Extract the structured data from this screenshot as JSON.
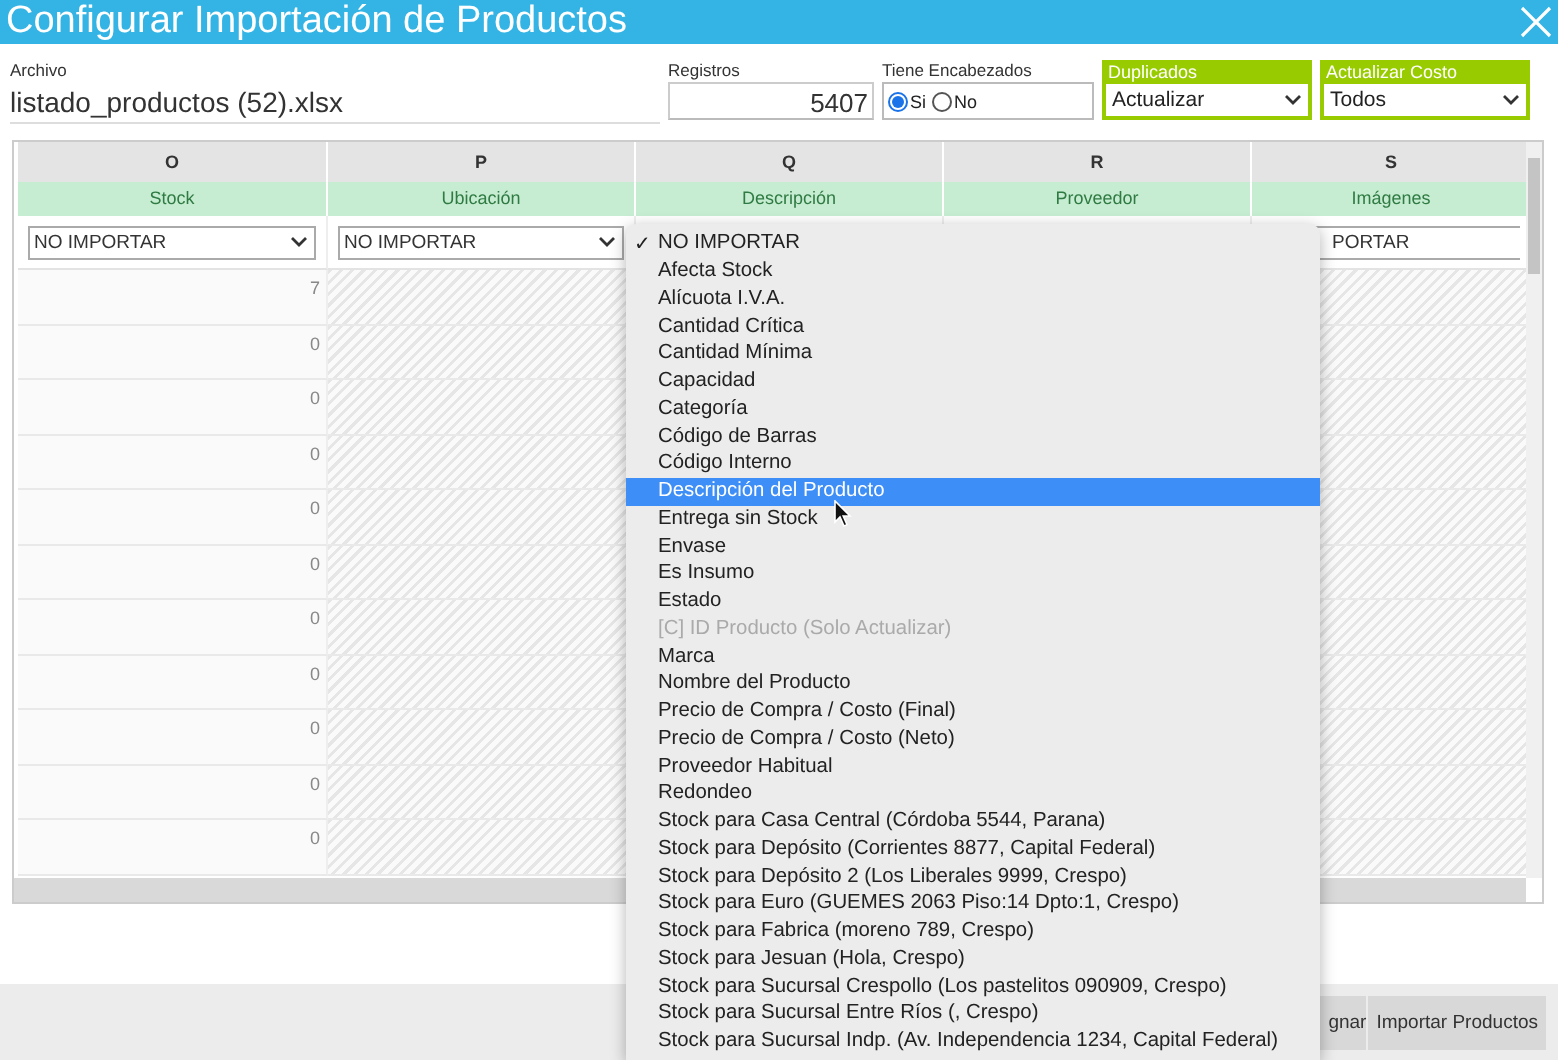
{
  "window": {
    "title": "Configurar Importación de Productos"
  },
  "form": {
    "archivo": {
      "label": "Archivo",
      "value": "listado_productos (52).xlsx"
    },
    "registros": {
      "label": "Registros",
      "value": "5407"
    },
    "encabezados": {
      "label": "Tiene Encabezados",
      "options": [
        {
          "label": "Si",
          "selected": true
        },
        {
          "label": "No",
          "selected": false
        }
      ]
    },
    "duplicados": {
      "label": "Duplicados",
      "value": "Actualizar"
    },
    "actualizar_costo": {
      "label": "Actualizar Costo",
      "value": "Todos"
    }
  },
  "grid": {
    "columns": [
      {
        "letter": "O",
        "name": "Stock",
        "mapping": "NO IMPORTAR",
        "enabled": true
      },
      {
        "letter": "P",
        "name": "Ubicación",
        "mapping": "NO IMPORTAR",
        "enabled": false
      },
      {
        "letter": "Q",
        "name": "Descripción"
      },
      {
        "letter": "R",
        "name": "Proveedor"
      },
      {
        "letter": "S",
        "name": "Imágenes",
        "mapping": "PORTAR",
        "enabled": false
      }
    ],
    "rows": [
      [
        "7"
      ],
      [
        "0"
      ],
      [
        "0"
      ],
      [
        "0"
      ],
      [
        "0"
      ],
      [
        "0"
      ],
      [
        "0"
      ],
      [
        "0"
      ],
      [
        "0"
      ],
      [
        "0"
      ],
      [
        "0"
      ]
    ]
  },
  "dropdown": {
    "check_mark": "✓",
    "items": [
      {
        "label": "NO IMPORTAR",
        "checked": true,
        "selected": false,
        "disabled": false
      },
      {
        "label": "Afecta Stock",
        "checked": false,
        "selected": false,
        "disabled": false
      },
      {
        "label": "Alícuota I.V.A.",
        "checked": false,
        "selected": false,
        "disabled": false
      },
      {
        "label": "Cantidad Crítica",
        "checked": false,
        "selected": false,
        "disabled": false
      },
      {
        "label": "Cantidad Mínima",
        "checked": false,
        "selected": false,
        "disabled": false
      },
      {
        "label": "Capacidad",
        "checked": false,
        "selected": false,
        "disabled": false
      },
      {
        "label": "Categoría",
        "checked": false,
        "selected": false,
        "disabled": false
      },
      {
        "label": "Código de Barras",
        "checked": false,
        "selected": false,
        "disabled": false
      },
      {
        "label": "Código Interno",
        "checked": false,
        "selected": false,
        "disabled": false
      },
      {
        "label": "Descripción del Producto",
        "checked": false,
        "selected": true,
        "disabled": false
      },
      {
        "label": "Entrega sin Stock",
        "checked": false,
        "selected": false,
        "disabled": false
      },
      {
        "label": "Envase",
        "checked": false,
        "selected": false,
        "disabled": false
      },
      {
        "label": "Es Insumo",
        "checked": false,
        "selected": false,
        "disabled": false
      },
      {
        "label": "Estado",
        "checked": false,
        "selected": false,
        "disabled": false
      },
      {
        "label": "[C] ID Producto (Solo Actualizar)",
        "checked": false,
        "selected": false,
        "disabled": true
      },
      {
        "label": "Marca",
        "checked": false,
        "selected": false,
        "disabled": false
      },
      {
        "label": "Nombre del Producto",
        "checked": false,
        "selected": false,
        "disabled": false
      },
      {
        "label": "Precio de Compra / Costo (Final)",
        "checked": false,
        "selected": false,
        "disabled": false
      },
      {
        "label": "Precio de Compra / Costo (Neto)",
        "checked": false,
        "selected": false,
        "disabled": false
      },
      {
        "label": "Proveedor Habitual",
        "checked": false,
        "selected": false,
        "disabled": false
      },
      {
        "label": "Redondeo",
        "checked": false,
        "selected": false,
        "disabled": false
      },
      {
        "label": "Stock para Casa Central (Córdoba 5544, Parana)",
        "checked": false,
        "selected": false,
        "disabled": false
      },
      {
        "label": "Stock para Depósito (Corrientes 8877, Capital Federal)",
        "checked": false,
        "selected": false,
        "disabled": false
      },
      {
        "label": "Stock para Depósito 2 (Los Liberales 9999, Crespo)",
        "checked": false,
        "selected": false,
        "disabled": false
      },
      {
        "label": "Stock para Euro (GUEMES 2063 Piso:14 Dpto:1, Crespo)",
        "checked": false,
        "selected": false,
        "disabled": false
      },
      {
        "label": "Stock para Fabrica (moreno 789, Crespo)",
        "checked": false,
        "selected": false,
        "disabled": false
      },
      {
        "label": "Stock para Jesuan (Hola, Crespo)",
        "checked": false,
        "selected": false,
        "disabled": false
      },
      {
        "label": "Stock para Sucursal Crespollo (Los pastelitos 090909, Crespo)",
        "checked": false,
        "selected": false,
        "disabled": false
      },
      {
        "label": "Stock para Sucursal Entre Ríos (, Crespo)",
        "checked": false,
        "selected": false,
        "disabled": false
      },
      {
        "label": "Stock para Sucursal Indp. (Av. Independencia 1234, Capital Federal)",
        "checked": false,
        "selected": false,
        "disabled": false
      }
    ]
  },
  "footer": {
    "buttons": [
      "gnar",
      "Importar Productos"
    ]
  }
}
